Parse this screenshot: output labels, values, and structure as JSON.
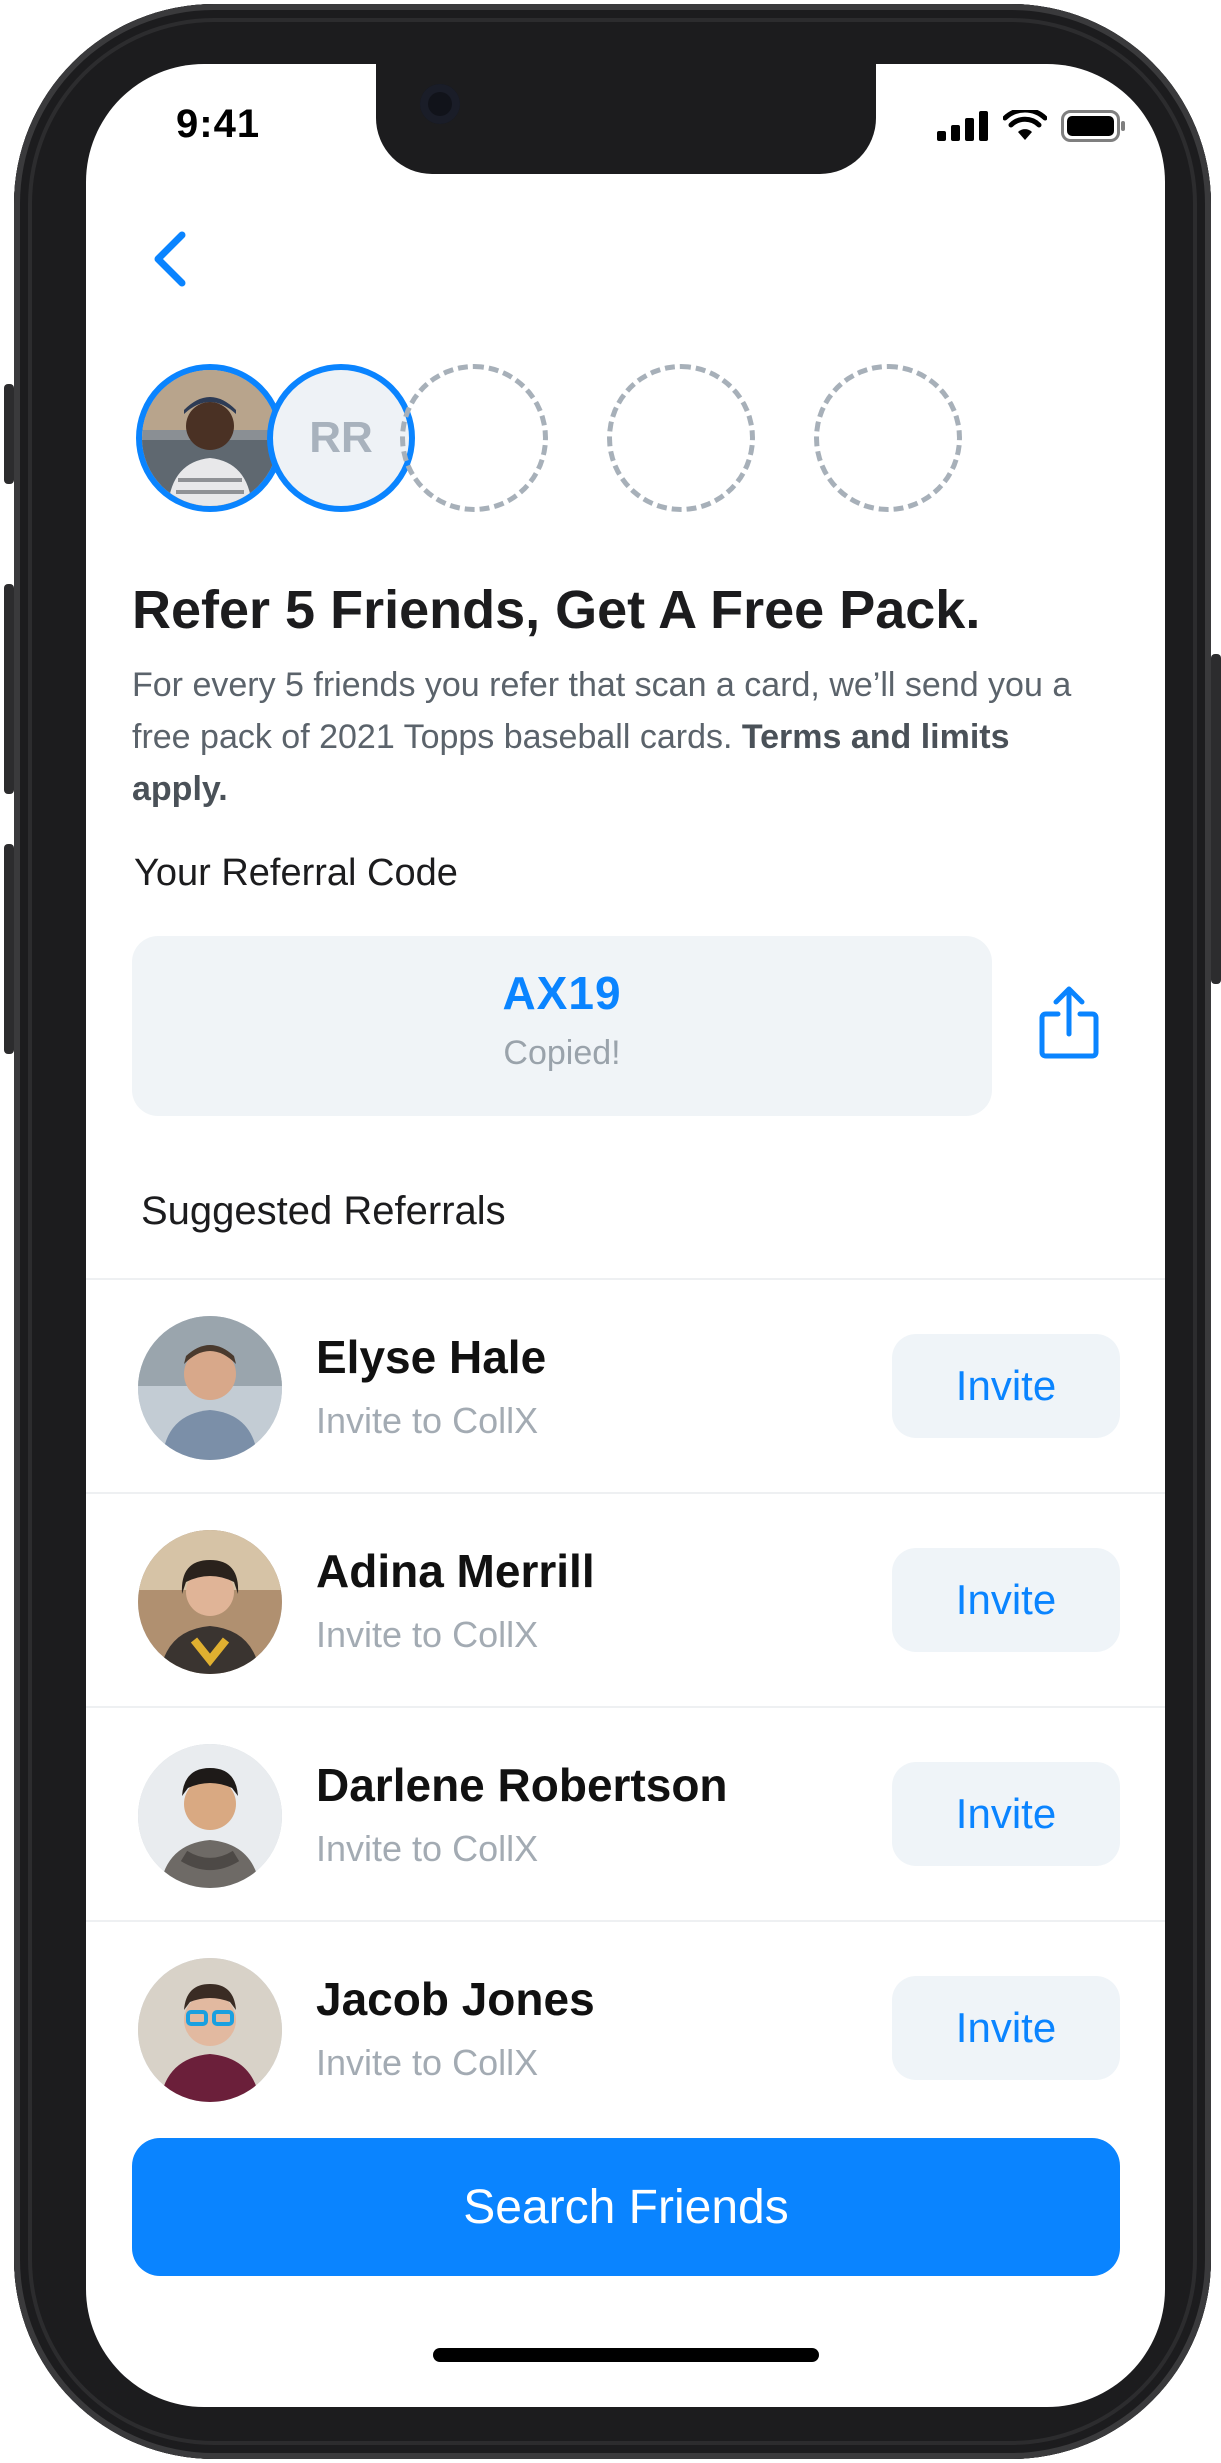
{
  "status_bar": {
    "time": "9:41"
  },
  "colors": {
    "accent": "#0a84ff",
    "code_bg": "#f0f4f7",
    "invite_bg": "#eff4f8"
  },
  "progress": {
    "total_slots": 5,
    "filled": 2,
    "slots": [
      {
        "type": "photo",
        "icon": "referred-user-avatar"
      },
      {
        "type": "initials",
        "label": "RR"
      },
      {
        "type": "empty"
      },
      {
        "type": "empty"
      },
      {
        "type": "empty"
      }
    ]
  },
  "headline": "Refer 5 Friends, Get A Free Pack.",
  "description": {
    "text": "For every 5 friends you refer that scan a card, we’ll send you a free pack of 2021 Topps baseball cards. ",
    "bold": "Terms and limits apply."
  },
  "referral": {
    "label": "Your Referral Code",
    "code": "AX19",
    "status": "Copied!"
  },
  "suggested": {
    "title": "Suggested Referrals",
    "invite_label": "Invite",
    "items": [
      {
        "name": "Elyse Hale",
        "subtitle": "Invite to CollX"
      },
      {
        "name": "Adina Merrill",
        "subtitle": "Invite to CollX"
      },
      {
        "name": "Darlene Robertson",
        "subtitle": "Invite to CollX"
      },
      {
        "name": "Jacob Jones",
        "subtitle": "Invite to CollX"
      }
    ]
  },
  "primary_button": "Search Friends"
}
